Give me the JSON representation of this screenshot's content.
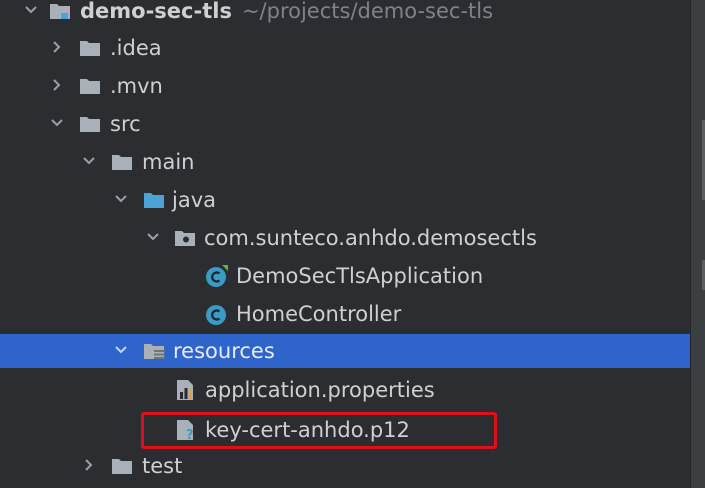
{
  "project_tree": {
    "root": {
      "name": "demo-sec-tls",
      "path": "~/projects/demo-sec-tls"
    },
    "items": [
      {
        "label": ".idea"
      },
      {
        "label": ".mvn"
      },
      {
        "label": "src"
      },
      {
        "label": "main"
      },
      {
        "label": "java"
      },
      {
        "label": "com.sunteco.anhdo.demosectls"
      },
      {
        "label": "DemoSecTlsApplication"
      },
      {
        "label": "HomeController"
      },
      {
        "label": "resources"
      },
      {
        "label": "application.properties"
      },
      {
        "label": "key-cert-anhdo.p12"
      },
      {
        "label": "test"
      }
    ],
    "selected_item": "resources",
    "highlighted_item": "key-cert-anhdo.p12"
  },
  "colors": {
    "background": "#2b2d30",
    "selection": "#2f65ca",
    "text": "#cdd1d4",
    "muted_text": "#7f8389",
    "folder": "#a9b0b8",
    "source_folder": "#4ba3d6",
    "class_icon": "#3a9bc4",
    "highlight_border": "#e0101a"
  },
  "icons": {
    "chevron_down": "chevron-down-icon",
    "chevron_right": "chevron-right-icon",
    "folder": "folder-icon",
    "module": "module-icon",
    "package": "package-icon",
    "class": "class-icon",
    "spring_boot_class": "spring-boot-class-icon",
    "resources_folder": "resources-folder-icon",
    "properties_file": "properties-file-icon",
    "unknown_file": "unknown-file-icon"
  }
}
